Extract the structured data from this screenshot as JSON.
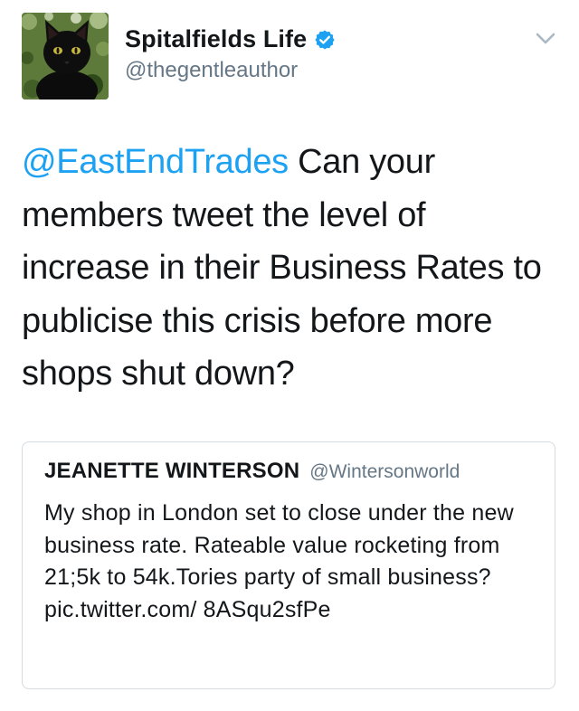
{
  "tweet": {
    "author": {
      "display_name": "Spitalfields Life",
      "handle": "@thegentleauthor",
      "verified": true,
      "avatar_icon": "black-cat-avatar"
    },
    "menu_icon": "chevron-down-icon",
    "text": {
      "mention": "@EastEndTrades",
      "body": " Can your members tweet the level of increase in their Business Rates to publicise this crisis before more shops shut down?"
    },
    "quoted_tweet": {
      "author_name": "JEANETTE WINTERSON",
      "author_handle": "@Wintersonworld",
      "text": "My shop in London set to close under the new business rate. Rateable value rocketing from 21;5k to 54k.Tories party of small business? pic.twitter.com/ 8ASqu2sfPe"
    }
  },
  "colors": {
    "text": "#14171a",
    "secondary": "#657786",
    "link": "#1da1f2",
    "border": "#d5dbe0",
    "verified_badge": "#1da1f2"
  }
}
